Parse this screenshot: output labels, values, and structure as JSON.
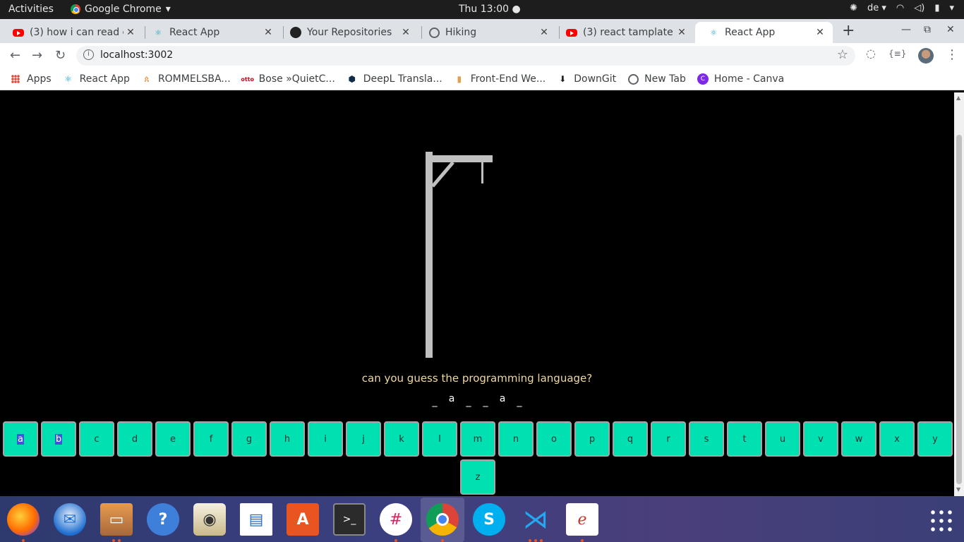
{
  "system": {
    "activities": "Activities",
    "app_name": "Google Chrome",
    "clock": "Thu 13:00 ●",
    "keyboard_layout": "de ▾"
  },
  "tabs": [
    {
      "title": "(3) how i can read e",
      "icon": "youtube-icon"
    },
    {
      "title": "React App",
      "icon": "react-icon"
    },
    {
      "title": "Your Repositories",
      "icon": "github-icon"
    },
    {
      "title": "Hiking",
      "icon": "globe-icon"
    },
    {
      "title": "(3) react tamplate -",
      "icon": "youtube-icon"
    },
    {
      "title": "React App",
      "icon": "react-icon",
      "active": true
    }
  ],
  "toolbar": {
    "url": "localhost:3002"
  },
  "bookmarks": [
    {
      "label": "Apps",
      "icon": "apps-grid-icon"
    },
    {
      "label": "React App",
      "icon": "react-icon"
    },
    {
      "label": "ROMMELSBA...",
      "icon": "rommelsbacher-icon"
    },
    {
      "label": "Bose »QuietC...",
      "icon": "otto-icon"
    },
    {
      "label": "DeepL Transla...",
      "icon": "deepl-icon"
    },
    {
      "label": "Front-End We...",
      "icon": "bookmark-icon"
    },
    {
      "label": "DownGit",
      "icon": "downgit-icon"
    },
    {
      "label": "New Tab",
      "icon": "globe-icon"
    },
    {
      "label": "Home - Canva",
      "icon": "canva-icon"
    }
  ],
  "game": {
    "question": "can you guess the programming language?",
    "word": [
      "_",
      "a",
      "_",
      "_",
      "a",
      "_"
    ],
    "letters": [
      "a",
      "b",
      "c",
      "d",
      "e",
      "f",
      "g",
      "h",
      "i",
      "j",
      "k",
      "l",
      "m",
      "n",
      "o",
      "p",
      "q",
      "r",
      "s",
      "t",
      "u",
      "v",
      "w",
      "x",
      "y",
      "z"
    ],
    "selected_letters": [
      "a",
      "b"
    ],
    "key_color": "#00e0b0",
    "gallows_color": "#c0c0c0",
    "question_color": "#f0d9a0"
  },
  "dock": [
    {
      "name": "firefox-icon"
    },
    {
      "name": "thunderbird-icon"
    },
    {
      "name": "files-icon"
    },
    {
      "name": "help-icon"
    },
    {
      "name": "rhythmbox-icon"
    },
    {
      "name": "writer-icon"
    },
    {
      "name": "software-center-icon"
    },
    {
      "name": "terminal-icon"
    },
    {
      "name": "slack-icon"
    },
    {
      "name": "chrome-icon",
      "active": true
    },
    {
      "name": "skype-icon"
    },
    {
      "name": "vscode-icon"
    },
    {
      "name": "pdf-viewer-icon"
    }
  ]
}
